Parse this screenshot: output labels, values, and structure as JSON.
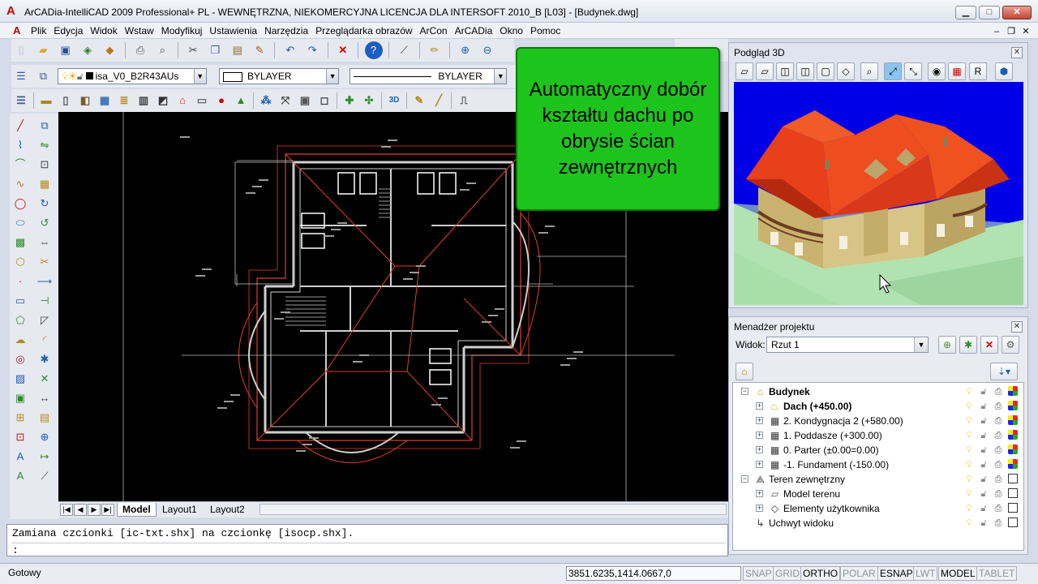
{
  "window": {
    "title": "ArCADia-IntelliCAD 2009 Professional+ PL - WEWNĘTRZNA, NIEKOMERCYJNA LICENCJA DLA INTERSOFT 2010_B [L03] - [Budynek.dwg]"
  },
  "menu": {
    "items": [
      "Plik",
      "Edycja",
      "Widok",
      "Wstaw",
      "Modyfikuj",
      "Ustawienia",
      "Narzędzia",
      "Przeglądarka obrazów",
      "ArCon",
      "ArCADia",
      "Okno",
      "Pomoc"
    ]
  },
  "layer_toolbar": {
    "layer_value": "isa_V0_B2R43AUs",
    "color_value": "BYLAYER",
    "linetype_value": "BYLAYER"
  },
  "tabs": {
    "model": "Model",
    "layout1": "Layout1",
    "layout2": "Layout2"
  },
  "command": {
    "history": "Zamiana czcionki [ic-txt.shx] na czcionkę [isocp.shx].",
    "prompt": ":"
  },
  "status": {
    "ready": "Gotowy",
    "coords": "3851.6235,1414.0667,0",
    "toggles": [
      {
        "label": "SNAP",
        "on": false
      },
      {
        "label": "GRID",
        "on": false
      },
      {
        "label": "ORTHO",
        "on": true
      },
      {
        "label": "POLAR",
        "on": false
      },
      {
        "label": "ESNAP",
        "on": true
      },
      {
        "label": "LWT",
        "on": false
      },
      {
        "label": "MODEL",
        "on": true
      },
      {
        "label": "TABLET",
        "on": false
      }
    ]
  },
  "callout": {
    "text": "Automatyczny dobór kształtu dachu po obrysie ścian zewnętrznych"
  },
  "preview3d": {
    "title": "Podgląd 3D",
    "render_button": "R"
  },
  "project_manager": {
    "title": "Menadżer projektu",
    "view_label": "Widok:",
    "view_value": "Rzut 1"
  },
  "tree": [
    {
      "label": "Budynek",
      "bold": true,
      "level": 0,
      "expand": "−",
      "icon": "building-icon"
    },
    {
      "label": "Dach (+450.00)",
      "bold": true,
      "level": 1,
      "expand": "+",
      "icon": "roof-icon"
    },
    {
      "label": "2. Kondygnacja 2 (+580.00)",
      "bold": false,
      "level": 1,
      "expand": "+",
      "icon": "storey-icon"
    },
    {
      "label": "1. Poddasze (+300.00)",
      "bold": false,
      "level": 1,
      "expand": "+",
      "icon": "storey-icon"
    },
    {
      "label": "0. Parter (±0.00=0.00)",
      "bold": false,
      "level": 1,
      "expand": "+",
      "icon": "storey-icon"
    },
    {
      "label": "-1. Fundament (-150.00)",
      "bold": false,
      "level": 1,
      "expand": "+",
      "icon": "storey-icon"
    },
    {
      "label": "Teren zewnętrzny",
      "bold": false,
      "level": 0,
      "expand": "−",
      "icon": "terrain-icon"
    },
    {
      "label": "Model terenu",
      "bold": false,
      "level": 1,
      "expand": "+",
      "icon": "terrain-model-icon"
    },
    {
      "label": "Elementy użytkownika",
      "bold": false,
      "level": 1,
      "expand": "+",
      "icon": "user-elements-icon"
    },
    {
      "label": "Uchwyt widoku",
      "bold": false,
      "level": 0,
      "expand": "",
      "icon": "view-handle-icon"
    }
  ],
  "colors": {
    "accent_green": "#1cc41c",
    "viewport_blue": "#0000e6",
    "roof": "#e8401a",
    "wall": "#c7b57a"
  }
}
